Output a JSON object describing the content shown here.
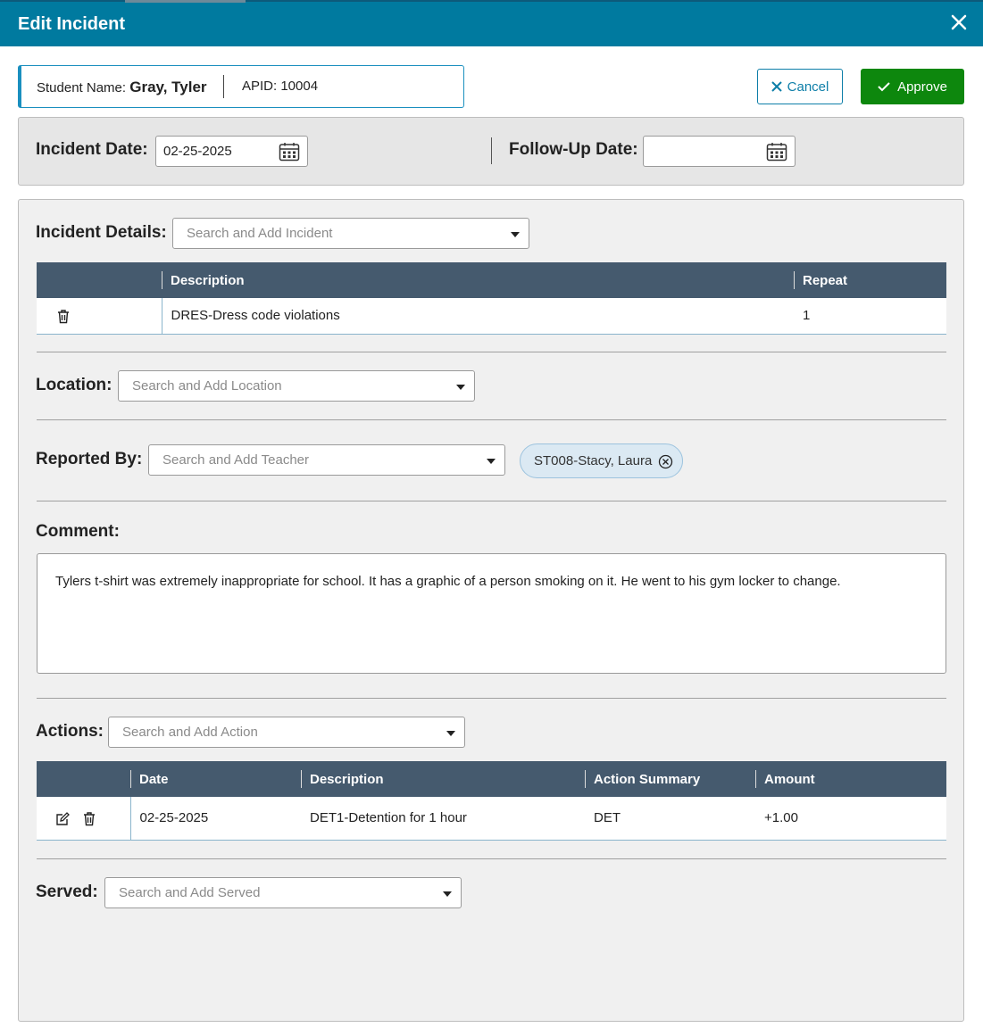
{
  "window": {
    "title": "Edit Incident"
  },
  "student": {
    "name_label": "Student Name:",
    "name_value": "Gray, Tyler",
    "apid": "APID: 10004"
  },
  "buttons": {
    "cancel": "Cancel",
    "approve": "Approve"
  },
  "dates": {
    "incident_label": "Incident Date:",
    "incident_value": "02-25-2025",
    "followup_label": "Follow-Up Date:",
    "followup_value": ""
  },
  "incident_details": {
    "label": "Incident Details:",
    "placeholder": "Search and Add Incident",
    "columns": {
      "description": "Description",
      "repeat": "Repeat"
    },
    "rows": [
      {
        "description": "DRES-Dress code violations",
        "repeat": "1"
      }
    ]
  },
  "location": {
    "label": "Location:",
    "placeholder": "Search and Add Location"
  },
  "reported_by": {
    "label": "Reported By:",
    "placeholder": "Search and Add Teacher",
    "chip": "ST008-Stacy, Laura"
  },
  "comment": {
    "label": "Comment:",
    "text": "Tylers t-shirt was extremely inappropriate for school. It has a graphic of a person smoking on it. He went to his gym locker to change."
  },
  "actions": {
    "label": "Actions:",
    "placeholder": "Search and Add Action",
    "columns": {
      "date": "Date",
      "description": "Description",
      "summary": "Action Summary",
      "amount": "Amount"
    },
    "rows": [
      {
        "date": "02-25-2025",
        "description": "DET1-Detention for 1 hour",
        "summary": "DET",
        "amount": "+1.00"
      }
    ]
  },
  "served": {
    "label": "Served:",
    "placeholder": "Search and Add Served"
  },
  "colors": {
    "header": "#007a9f",
    "approve": "#0d870d",
    "grid_header": "#455a6e",
    "accent": "#1a8fbf"
  }
}
